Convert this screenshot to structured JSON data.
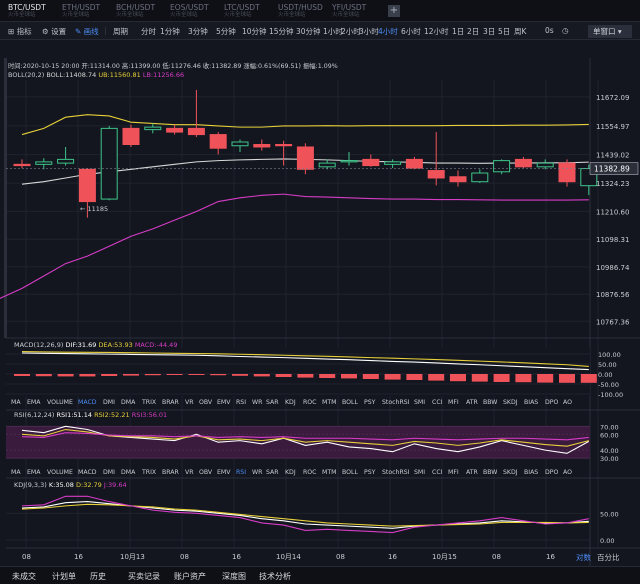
{
  "symbol_tabs": [
    {
      "name": "BTC/USDT",
      "sub": "火币全球站"
    },
    {
      "name": "ETH/USDT",
      "sub": "火币全球站"
    },
    {
      "name": "BCH/USDT",
      "sub": "火币全球站"
    },
    {
      "name": "EOS/USDT",
      "sub": "火币全球站"
    },
    {
      "name": "LTC/USDT",
      "sub": "火币全球站"
    },
    {
      "name": "USDT/HUSD",
      "sub": "火币全球站"
    },
    {
      "name": "YFI/USDT",
      "sub": "火币全球站"
    }
  ],
  "add_symbol": "+",
  "toolbar": {
    "indicator": "指标",
    "settings": "设置",
    "draw": "画线",
    "period_label": "周期",
    "periods": [
      "分时",
      "1分钟",
      "3分钟",
      "5分钟",
      "10分钟",
      "15分钟",
      "30分钟",
      "1小时",
      "2小时",
      "3小时",
      "4小时",
      "6小时",
      "12小时",
      "1日",
      "2日",
      "3日",
      "5日",
      "周K"
    ],
    "active_period": "4小时",
    "timezone": "0s",
    "exchange": "单窗口"
  },
  "info": {
    "line": "时间:2020-10-15 20:00  开:11314.00  高:11399.00  低:11276.46  收:11382.89  涨幅:0.61%(69.51)  振幅:1.09%",
    "boll_title": "BOLL(20,2)",
    "boll_mid": "BOLL:11408.74",
    "boll_ub": "UB:11560.81",
    "boll_lb": "LB:11256.66",
    "macd_title": "MACD(12,26,9)",
    "dif": "DIF:31.69",
    "dea": "DEA:53.93",
    "macd": "MACD:-44.49",
    "rsi_title": "RSI(6,12,24)",
    "rsi1": "RSI1:51.14",
    "rsi2": "RSI2:52.21",
    "rsi3": "RSI3:56.01",
    "kdj_title": "KDJ(9,3,3)",
    "k": "K:35.08",
    "d": "D:32.79",
    "j": "J:39.64"
  },
  "indicators": [
    "MA",
    "EMA",
    "VOLUME",
    "MACD",
    "DMI",
    "DMA",
    "TRIX",
    "BRAR",
    "VR",
    "OBV",
    "EMV",
    "RSI",
    "WR",
    "SAR",
    "KDJ",
    "ROC",
    "MTM",
    "BOLL",
    "PSY",
    "StochRSI",
    "SMI",
    "CCI",
    "MFI",
    "ATR",
    "BBW",
    "SKDJ",
    "BIAS",
    "DPO",
    "AO"
  ],
  "active_macd_row": "MACD",
  "active_rsi_row": "RSI",
  "price_labels": [
    "11672.09",
    "11554.97",
    "11439.02",
    "11324.23",
    "11210.60",
    "11098.31",
    "10986.74",
    "10876.56",
    "10767.36"
  ],
  "current_price": "11382.89",
  "low_marker": "← 11185",
  "macd_labels": [
    "100.00",
    "50.00",
    "0.00",
    "-50.00",
    "-100.00"
  ],
  "rsi_labels": [
    "70.00",
    "60.00",
    "40.00",
    "30.00"
  ],
  "kdj_labels": [
    "50.00",
    "0.00"
  ],
  "x_labels": [
    "08",
    "16",
    "10月13",
    "08",
    "16",
    "10月14",
    "08",
    "16",
    "10月15",
    "08",
    "16"
  ],
  "axis_opts": {
    "log": "对数",
    "percent": "百分比"
  },
  "bottom_tabs": [
    "未成交",
    "计划单",
    "历史",
    "买卖记录",
    "账户资产",
    "深度图",
    "技术分析"
  ],
  "colors": {
    "up": "#3ec48a",
    "down": "#f0525a",
    "boll_mid": "#d8d8d8",
    "boll_ub": "#e6cf3a",
    "boll_lb": "#d63cc7",
    "dif": "#ffffff",
    "dea": "#e6cf3a",
    "bg": "#13161e"
  },
  "candles": [
    {
      "o": 11400,
      "h": 11420,
      "l": 11385,
      "c": 11395
    },
    {
      "o": 11400,
      "h": 11425,
      "l": 11380,
      "c": 11410
    },
    {
      "o": 11405,
      "h": 11470,
      "l": 11395,
      "c": 11420
    },
    {
      "o": 11380,
      "h": 11385,
      "l": 11185,
      "c": 11250
    },
    {
      "o": 11260,
      "h": 11555,
      "l": 11255,
      "c": 11545
    },
    {
      "o": 11545,
      "h": 11560,
      "l": 11470,
      "c": 11480
    },
    {
      "o": 11540,
      "h": 11565,
      "l": 11525,
      "c": 11550
    },
    {
      "o": 11545,
      "h": 11560,
      "l": 11520,
      "c": 11530
    },
    {
      "o": 11545,
      "h": 11700,
      "l": 11510,
      "c": 11520
    },
    {
      "o": 11520,
      "h": 11530,
      "l": 11440,
      "c": 11465
    },
    {
      "o": 11475,
      "h": 11500,
      "l": 11450,
      "c": 11490
    },
    {
      "o": 11480,
      "h": 11500,
      "l": 11455,
      "c": 11470
    },
    {
      "o": 11480,
      "h": 11495,
      "l": 11395,
      "c": 11475
    },
    {
      "o": 11470,
      "h": 11485,
      "l": 11360,
      "c": 11380
    },
    {
      "o": 11390,
      "h": 11420,
      "l": 11380,
      "c": 11405
    },
    {
      "o": 11410,
      "h": 11450,
      "l": 11395,
      "c": 11415
    },
    {
      "o": 11420,
      "h": 11440,
      "l": 11390,
      "c": 11395
    },
    {
      "o": 11400,
      "h": 11420,
      "l": 11385,
      "c": 11410
    },
    {
      "o": 11420,
      "h": 11430,
      "l": 11380,
      "c": 11385
    },
    {
      "o": 11375,
      "h": 11530,
      "l": 11315,
      "c": 11345
    },
    {
      "o": 11350,
      "h": 11375,
      "l": 11310,
      "c": 11330
    },
    {
      "o": 11330,
      "h": 11380,
      "l": 11325,
      "c": 11365
    },
    {
      "o": 11370,
      "h": 11420,
      "l": 11360,
      "c": 11415
    },
    {
      "o": 11420,
      "h": 11430,
      "l": 11385,
      "c": 11390
    },
    {
      "o": 11390,
      "h": 11420,
      "l": 11380,
      "c": 11405
    },
    {
      "o": 11405,
      "h": 11420,
      "l": 11310,
      "c": 11330
    },
    {
      "o": 11314,
      "h": 11399,
      "l": 11276,
      "c": 11383
    }
  ],
  "boll": {
    "ub": [
      11520,
      11545,
      11590,
      11600,
      11595,
      11570,
      11565,
      11560,
      11560,
      11555,
      11550,
      11550,
      11555,
      11555,
      11556,
      11555,
      11556,
      11556,
      11556,
      11556,
      11557,
      11557,
      11557,
      11558,
      11558,
      11559,
      11561
    ],
    "mid": [
      11320,
      11330,
      11345,
      11360,
      11370,
      11380,
      11390,
      11400,
      11410,
      11415,
      11418,
      11420,
      11422,
      11420,
      11418,
      11415,
      11412,
      11410,
      11408,
      11405,
      11405,
      11404,
      11405,
      11405,
      11406,
      11406,
      11409
    ],
    "lb": [
      10900,
      10950,
      11000,
      11030,
      11070,
      11110,
      11140,
      11175,
      11210,
      11250,
      11265,
      11275,
      11280,
      11270,
      11268,
      11265,
      11262,
      11260,
      11260,
      11258,
      11258,
      11257,
      11256,
      11256,
      11256,
      11256,
      11257
    ]
  },
  "macd": {
    "hist": [
      -10,
      -11,
      -12,
      -12,
      -10,
      -8,
      -6,
      -5,
      -4,
      -6,
      -9,
      -12,
      -15,
      -18,
      -20,
      -22,
      -25,
      -28,
      -30,
      -33,
      -36,
      -38,
      -40,
      -41,
      -43,
      -44,
      -44
    ],
    "dif": [
      150,
      148,
      146,
      144,
      142,
      140,
      138,
      136,
      134,
      130,
      125,
      121,
      117,
      112,
      107,
      102,
      96,
      90,
      85,
      79,
      72,
      66,
      59,
      52,
      45,
      38,
      32
    ],
    "dea": [
      160,
      158,
      156,
      155,
      154,
      152,
      150,
      148,
      146,
      144,
      141,
      138,
      134,
      130,
      126,
      122,
      117,
      113,
      108,
      103,
      98,
      92,
      86,
      80,
      73,
      66,
      54
    ]
  },
  "rsi": {
    "r1": [
      65,
      62,
      70,
      66,
      58,
      56,
      54,
      52,
      60,
      50,
      52,
      48,
      55,
      46,
      50,
      44,
      42,
      38,
      48,
      42,
      38,
      44,
      52,
      46,
      40,
      36,
      51
    ],
    "r2": [
      60,
      58,
      66,
      63,
      58,
      57,
      56,
      54,
      58,
      53,
      54,
      52,
      55,
      50,
      52,
      50,
      48,
      46,
      51,
      49,
      46,
      49,
      53,
      50,
      47,
      45,
      52
    ],
    "r3": [
      57,
      56,
      62,
      61,
      59,
      58,
      58,
      57,
      58,
      56,
      57,
      56,
      57,
      55,
      55,
      55,
      54,
      53,
      55,
      54,
      53,
      54,
      55,
      55,
      54,
      53,
      56
    ]
  },
  "kdj": {
    "k": [
      60,
      62,
      70,
      72,
      68,
      64,
      60,
      56,
      54,
      50,
      46,
      40,
      36,
      30,
      28,
      26,
      24,
      22,
      26,
      28,
      30,
      32,
      36,
      34,
      32,
      32,
      35
    ],
    "d": [
      58,
      60,
      64,
      67,
      66,
      64,
      62,
      58,
      56,
      52,
      48,
      44,
      40,
      36,
      32,
      30,
      28,
      26,
      27,
      28,
      29,
      30,
      33,
      33,
      33,
      32,
      33
    ],
    "j": [
      64,
      66,
      82,
      82,
      72,
      64,
      56,
      52,
      50,
      46,
      42,
      32,
      28,
      18,
      20,
      18,
      16,
      14,
      24,
      28,
      32,
      36,
      42,
      36,
      30,
      32,
      40
    ]
  }
}
